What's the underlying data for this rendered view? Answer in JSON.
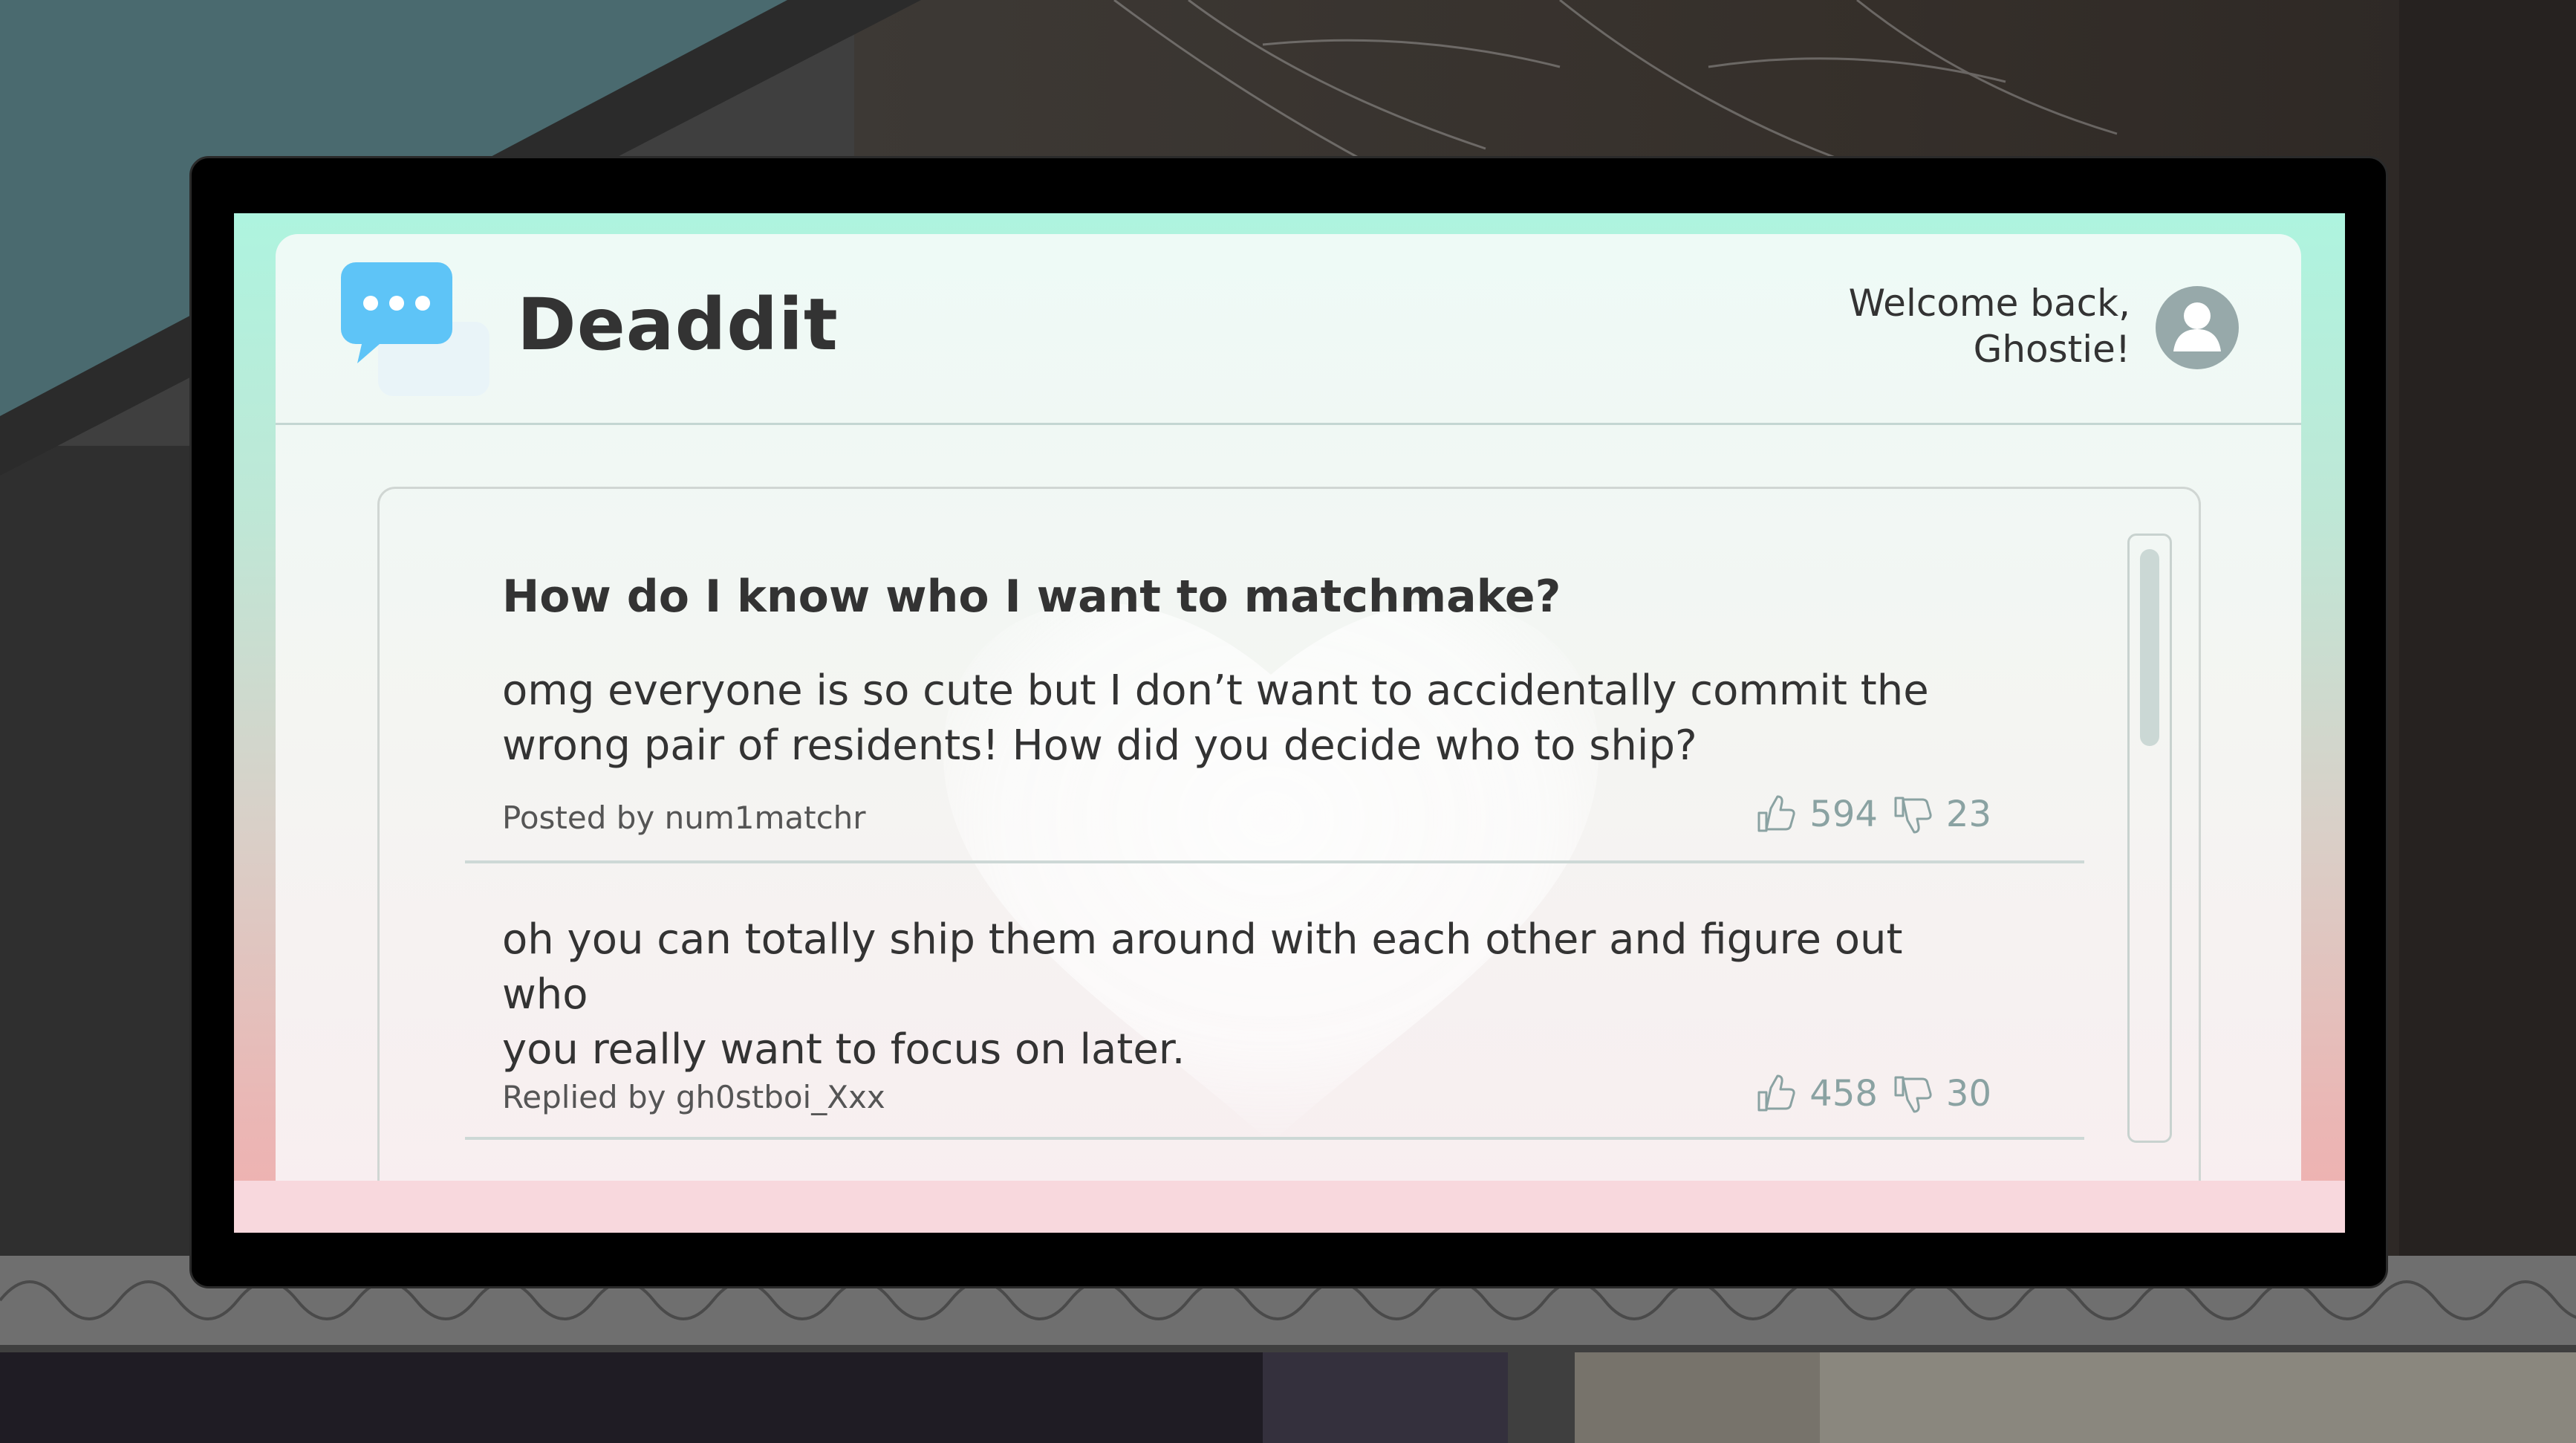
{
  "app": {
    "title": "Deaddit",
    "welcome_line1": "Welcome back,",
    "welcome_line2": "Ghostie!"
  },
  "icons": {
    "logo": "chat-bubbles-icon",
    "avatar": "user-avatar-icon",
    "upvote": "thumbs-up-icon",
    "downvote": "thumbs-down-icon"
  },
  "colors": {
    "logo_blue": "#5ec4f7",
    "vote_grey": "#8aa2a2"
  },
  "thread": {
    "post": {
      "title": "How do I know who I want to matchmake?",
      "body_line1": "omg everyone is so cute but I don’t want to accidentally commit the",
      "body_line2": "wrong pair of residents! How did you decide who to ship?",
      "byline": "Posted by num1matchr",
      "upvotes": "594",
      "downvotes": "23"
    },
    "reply": {
      "body_line1": "oh you can totally ship them around with each other and figure out who",
      "body_line2": "you really want to focus on later.",
      "byline": "Replied by gh0stboi_Xxx",
      "upvotes": "458",
      "downvotes": "30"
    }
  }
}
